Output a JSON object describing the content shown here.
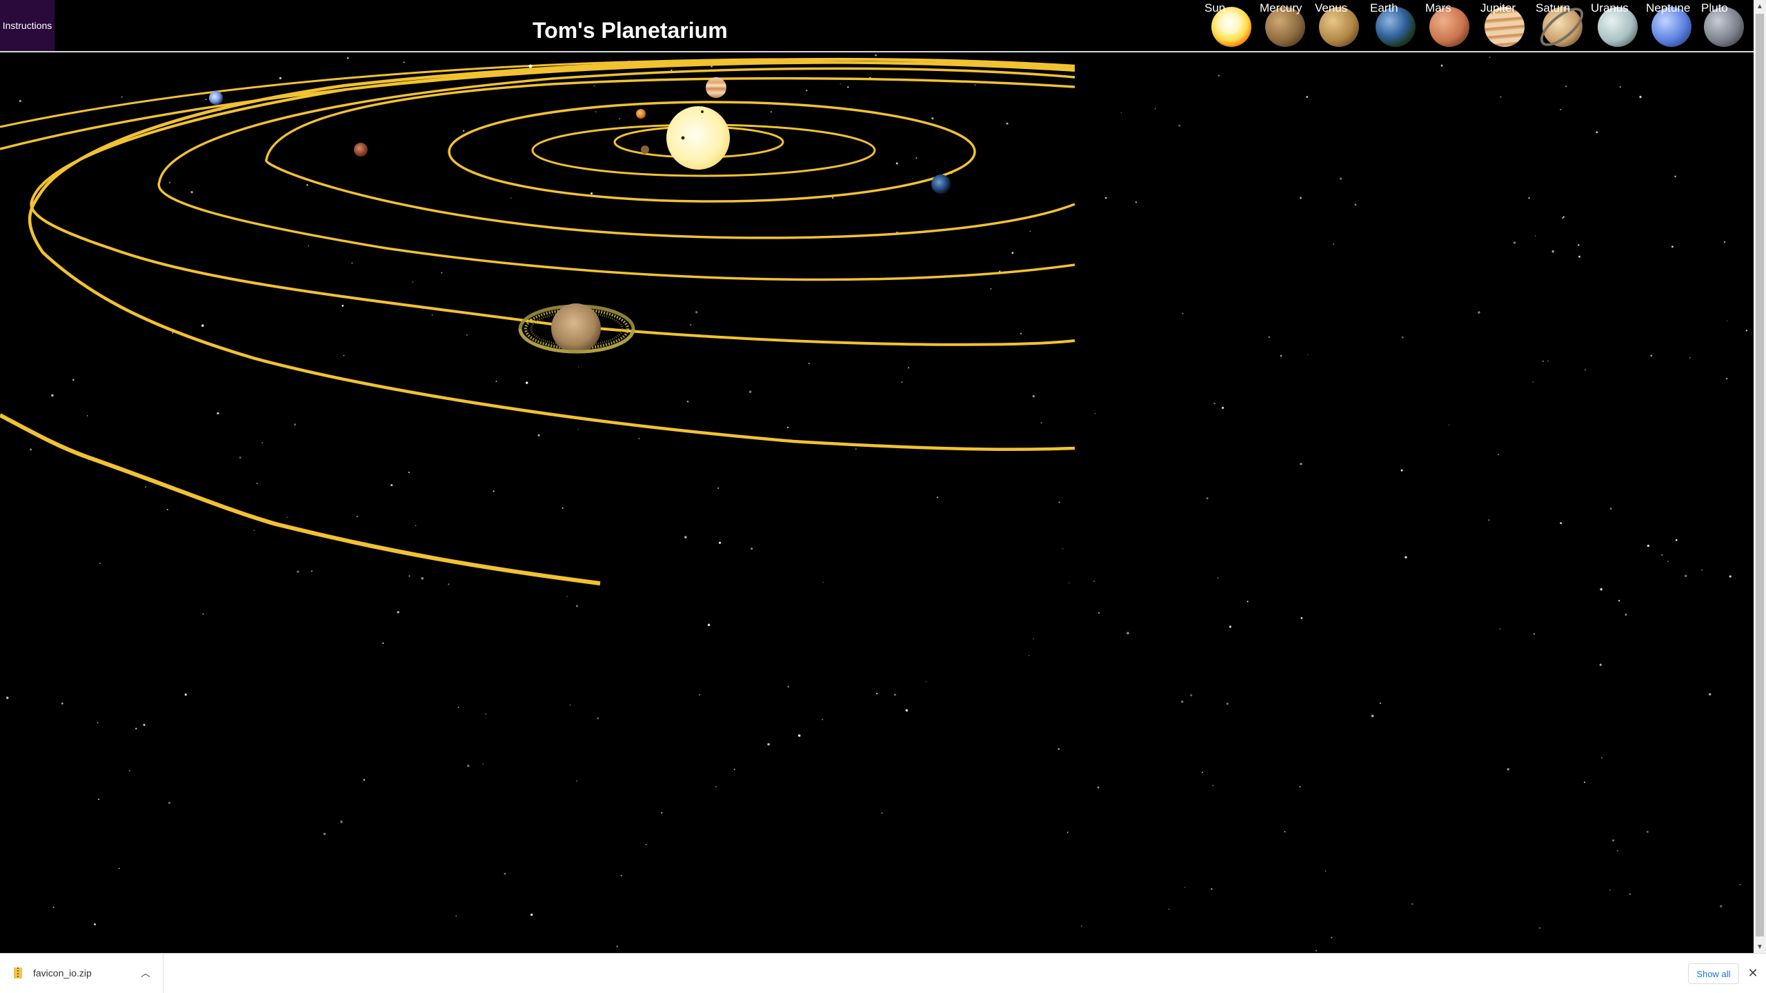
{
  "header": {
    "instructions_label": "Instructions",
    "title": "Tom's Planetarium"
  },
  "planet_nav": [
    {
      "label": "Sun",
      "icon": "sun-icon"
    },
    {
      "label": "Mercury",
      "icon": "mercury-icon"
    },
    {
      "label": "Venus",
      "icon": "venus-icon"
    },
    {
      "label": "Earth",
      "icon": "earth-icon"
    },
    {
      "label": "Mars",
      "icon": "mars-icon"
    },
    {
      "label": "Jupiter",
      "icon": "jupiter-icon"
    },
    {
      "label": "Saturn",
      "icon": "saturn-icon"
    },
    {
      "label": "Uranus",
      "icon": "uranus-icon"
    },
    {
      "label": "Neptune",
      "icon": "neptune-icon"
    },
    {
      "label": "Pluto",
      "icon": "pluto-icon"
    }
  ],
  "scene": {
    "orbit_color": "#f2c230",
    "background": "#000000"
  },
  "download_bar": {
    "file_name": "favicon_io.zip",
    "show_all_label": "Show all",
    "close_icon": "close-icon"
  }
}
